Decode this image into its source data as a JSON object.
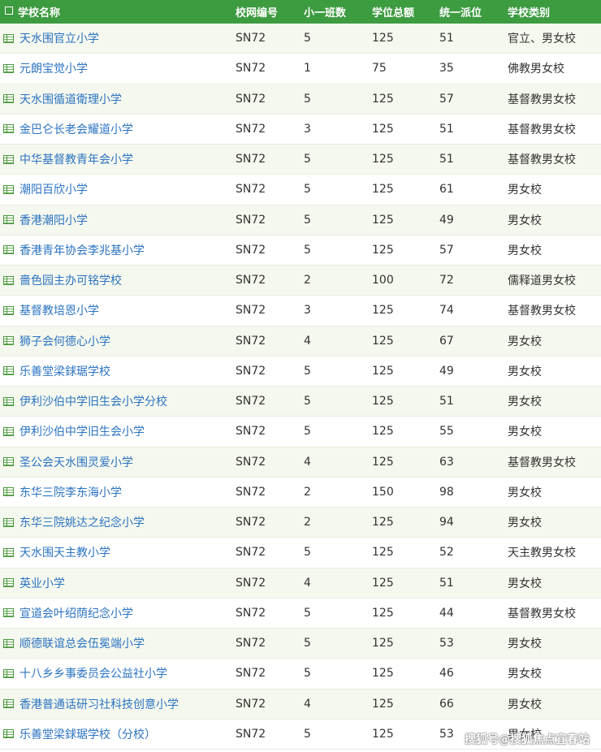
{
  "header": {
    "name": "学校名称",
    "code": "校网编号",
    "classes": "小一班数",
    "total": "学位总额",
    "allocation": "统一派位",
    "type": "学校类别"
  },
  "rows": [
    {
      "name": "天水围官立小学",
      "code": "SN72",
      "classes": "5",
      "total": "125",
      "allocation": "51",
      "type": "官立、男女校"
    },
    {
      "name": "元朗宝觉小学",
      "code": "SN72",
      "classes": "1",
      "total": "75",
      "allocation": "35",
      "type": "佛教男女校"
    },
    {
      "name": "天水围循道衛理小学",
      "code": "SN72",
      "classes": "5",
      "total": "125",
      "allocation": "57",
      "type": "基督教男女校"
    },
    {
      "name": "金巴仑长老会耀道小学",
      "code": "SN72",
      "classes": "3",
      "total": "125",
      "allocation": "51",
      "type": "基督教男女校"
    },
    {
      "name": "中华基督教青年会小学",
      "code": "SN72",
      "classes": "5",
      "total": "125",
      "allocation": "51",
      "type": "基督教男女校"
    },
    {
      "name": "潮阳百欣小学",
      "code": "SN72",
      "classes": "5",
      "total": "125",
      "allocation": "61",
      "type": "男女校"
    },
    {
      "name": "香港潮阳小学",
      "code": "SN72",
      "classes": "5",
      "total": "125",
      "allocation": "49",
      "type": "男女校"
    },
    {
      "name": "香港青年协会李兆基小学",
      "code": "SN72",
      "classes": "5",
      "total": "125",
      "allocation": "57",
      "type": "男女校"
    },
    {
      "name": "嗇色园主办可铭学校",
      "code": "SN72",
      "classes": "2",
      "total": "100",
      "allocation": "72",
      "type": "儒释道男女校"
    },
    {
      "name": "基督教培恩小学",
      "code": "SN72",
      "classes": "3",
      "total": "125",
      "allocation": "74",
      "type": "基督教男女校"
    },
    {
      "name": "狮子会何德心小学",
      "code": "SN72",
      "classes": "4",
      "total": "125",
      "allocation": "67",
      "type": "男女校"
    },
    {
      "name": "乐善堂梁銶琚学校",
      "code": "SN72",
      "classes": "5",
      "total": "125",
      "allocation": "49",
      "type": "男女校"
    },
    {
      "name": "伊利沙伯中学旧生会小学分校",
      "code": "SN72",
      "classes": "5",
      "total": "125",
      "allocation": "51",
      "type": "男女校"
    },
    {
      "name": "伊利沙伯中学旧生会小学",
      "code": "SN72",
      "classes": "5",
      "total": "125",
      "allocation": "55",
      "type": "男女校"
    },
    {
      "name": "圣公会天水围灵爱小学",
      "code": "SN72",
      "classes": "4",
      "total": "125",
      "allocation": "63",
      "type": "基督教男女校"
    },
    {
      "name": "东华三院李东海小学",
      "code": "SN72",
      "classes": "2",
      "total": "150",
      "allocation": "98",
      "type": "男女校"
    },
    {
      "name": "东华三院姚达之纪念小学",
      "code": "SN72",
      "classes": "2",
      "total": "125",
      "allocation": "94",
      "type": "男女校"
    },
    {
      "name": "天水围天主教小学",
      "code": "SN72",
      "classes": "5",
      "total": "125",
      "allocation": "52",
      "type": "天主教男女校"
    },
    {
      "name": "英业小学",
      "code": "SN72",
      "classes": "4",
      "total": "125",
      "allocation": "51",
      "type": "男女校"
    },
    {
      "name": "宣道会叶绍荫纪念小学",
      "code": "SN72",
      "classes": "5",
      "total": "125",
      "allocation": "44",
      "type": "基督教男女校"
    },
    {
      "name": "顺德联谊总会伍冕端小学",
      "code": "SN72",
      "classes": "5",
      "total": "125",
      "allocation": "53",
      "type": "男女校"
    },
    {
      "name": "十八乡乡事委员会公益社小学",
      "code": "SN72",
      "classes": "5",
      "total": "125",
      "allocation": "46",
      "type": "男女校"
    },
    {
      "name": "香港普通话研习社科技创意小学",
      "code": "SN72",
      "classes": "4",
      "total": "125",
      "allocation": "66",
      "type": "男女校"
    },
    {
      "name": "乐善堂梁銶琚学校（分校）",
      "code": "SN72",
      "classes": "5",
      "total": "125",
      "allocation": "53",
      "type": "男女校"
    }
  ],
  "watermark": "搜狐号@搜狐焦点宜春站",
  "colors": {
    "header_bg": "#3d9b40",
    "name_link": "#2b73c2",
    "row_alt": "#f5f8ee"
  }
}
